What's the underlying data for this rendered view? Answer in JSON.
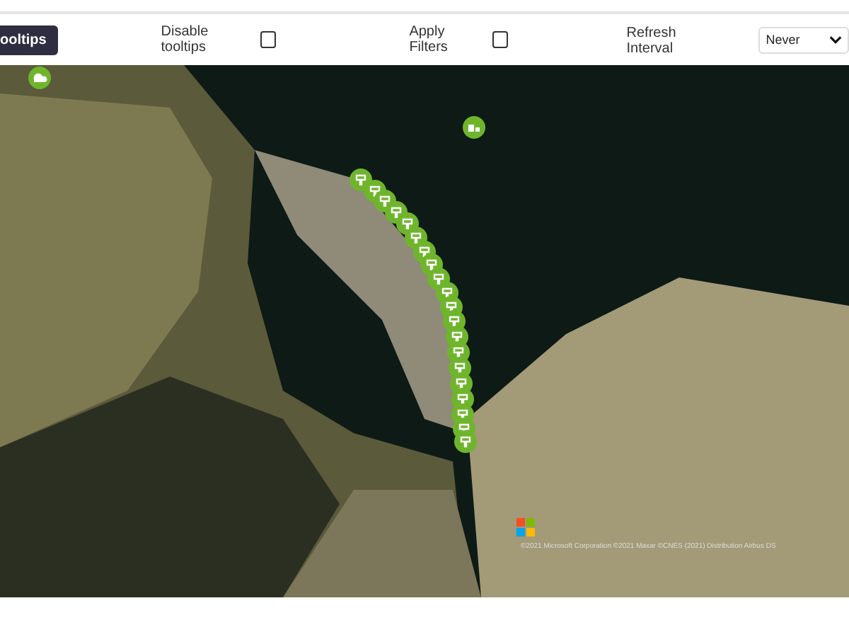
{
  "toolbar": {
    "tooltips_button": "ooltips",
    "checkboxes": [
      {
        "label": "Disable tooltips",
        "checked": false
      },
      {
        "label": "Apply Filters",
        "checked": false
      }
    ],
    "refresh": {
      "label": "Refresh Interval",
      "value": "Never"
    }
  },
  "map": {
    "attribution": "©2021 Microsoft Corporation ©2021 Maxar ©CNES (2021) Distribution Airbus DS"
  }
}
